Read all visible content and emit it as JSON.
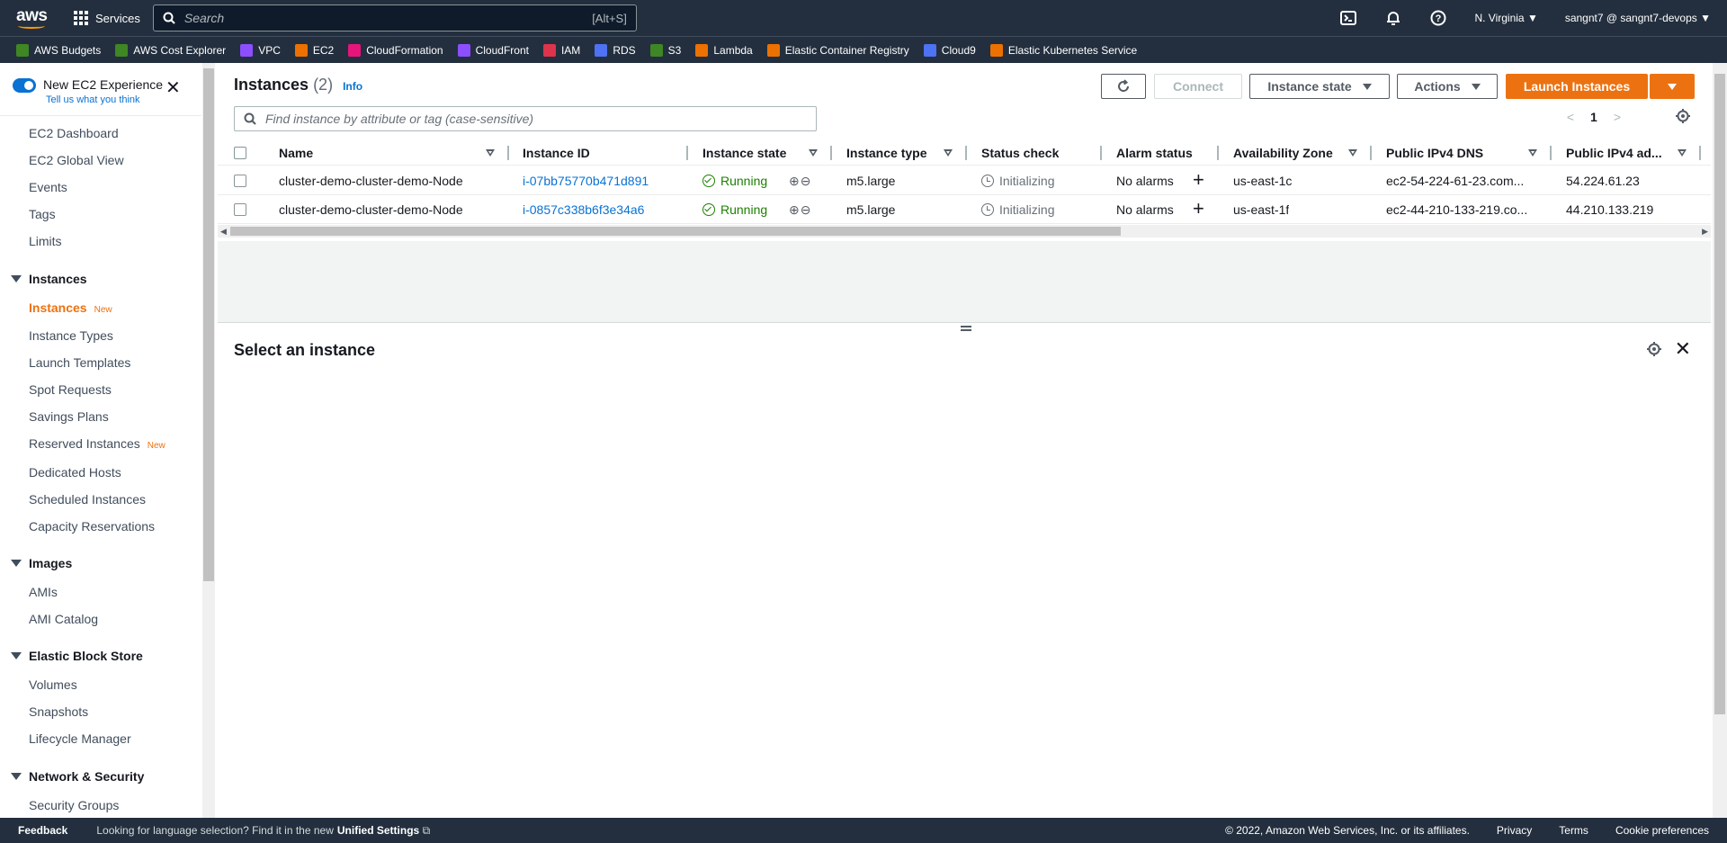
{
  "topbar": {
    "logo": "aws",
    "services_label": "Services",
    "search_placeholder": "Search",
    "search_shortcut": "[Alt+S]",
    "region": "N. Virginia",
    "account": "sangnt7 @ sangnt7-devops"
  },
  "favorites": [
    {
      "label": "AWS Budgets",
      "color": "#3f8624"
    },
    {
      "label": "AWS Cost Explorer",
      "color": "#3f8624"
    },
    {
      "label": "VPC",
      "color": "#8c4fff"
    },
    {
      "label": "EC2",
      "color": "#ed7100"
    },
    {
      "label": "CloudFormation",
      "color": "#e7157b"
    },
    {
      "label": "CloudFront",
      "color": "#8c4fff"
    },
    {
      "label": "IAM",
      "color": "#dd344c"
    },
    {
      "label": "RDS",
      "color": "#4d72f3"
    },
    {
      "label": "S3",
      "color": "#3f8624"
    },
    {
      "label": "Lambda",
      "color": "#ed7100"
    },
    {
      "label": "Elastic Container Registry",
      "color": "#ed7100"
    },
    {
      "label": "Cloud9",
      "color": "#4d72f3"
    },
    {
      "label": "Elastic Kubernetes Service",
      "color": "#ed7100"
    }
  ],
  "sidebar": {
    "new_exp_title": "New EC2 Experience",
    "new_exp_sub": "Tell us what you think",
    "new_badge": "New",
    "top_items": [
      "EC2 Dashboard",
      "EC2 Global View",
      "Events",
      "Tags",
      "Limits"
    ],
    "sections": [
      {
        "title": "Instances",
        "items": [
          "Instances",
          "Instance Types",
          "Launch Templates",
          "Spot Requests",
          "Savings Plans",
          "Reserved Instances",
          "Dedicated Hosts",
          "Scheduled Instances",
          "Capacity Reservations"
        ]
      },
      {
        "title": "Images",
        "items": [
          "AMIs",
          "AMI Catalog"
        ]
      },
      {
        "title": "Elastic Block Store",
        "items": [
          "Volumes",
          "Snapshots",
          "Lifecycle Manager"
        ]
      },
      {
        "title": "Network & Security",
        "items": [
          "Security Groups"
        ]
      }
    ]
  },
  "instances": {
    "title": "Instances",
    "count": "(2)",
    "info": "Info",
    "connect": "Connect",
    "instance_state": "Instance state",
    "actions": "Actions",
    "launch": "Launch Instances",
    "filter_placeholder": "Find instance by attribute or tag (case-sensitive)",
    "page": "1",
    "columns": [
      "Name",
      "Instance ID",
      "Instance state",
      "Instance type",
      "Status check",
      "Alarm status",
      "Availability Zone",
      "Public IPv4 DNS",
      "Public IPv4 ad..."
    ],
    "rows": [
      {
        "name": "cluster-demo-cluster-demo-Node",
        "id": "i-07bb75770b471d891",
        "state": "Running",
        "type": "m5.large",
        "status": "Initializing",
        "alarm": "No alarms",
        "az": "us-east-1c",
        "dns": "ec2-54-224-61-23.com...",
        "ip": "54.224.61.23"
      },
      {
        "name": "cluster-demo-cluster-demo-Node",
        "id": "i-0857c338b6f3e34a6",
        "state": "Running",
        "type": "m5.large",
        "status": "Initializing",
        "alarm": "No alarms",
        "az": "us-east-1f",
        "dns": "ec2-44-210-133-219.co...",
        "ip": "44.210.133.219"
      }
    ]
  },
  "detail": {
    "title": "Select an instance"
  },
  "footer": {
    "feedback": "Feedback",
    "message": "Looking for language selection? Find it in the new",
    "unified": "Unified Settings",
    "copyright": "© 2022, Amazon Web Services, Inc. or its affiliates.",
    "privacy": "Privacy",
    "terms": "Terms",
    "cookies": "Cookie preferences"
  }
}
